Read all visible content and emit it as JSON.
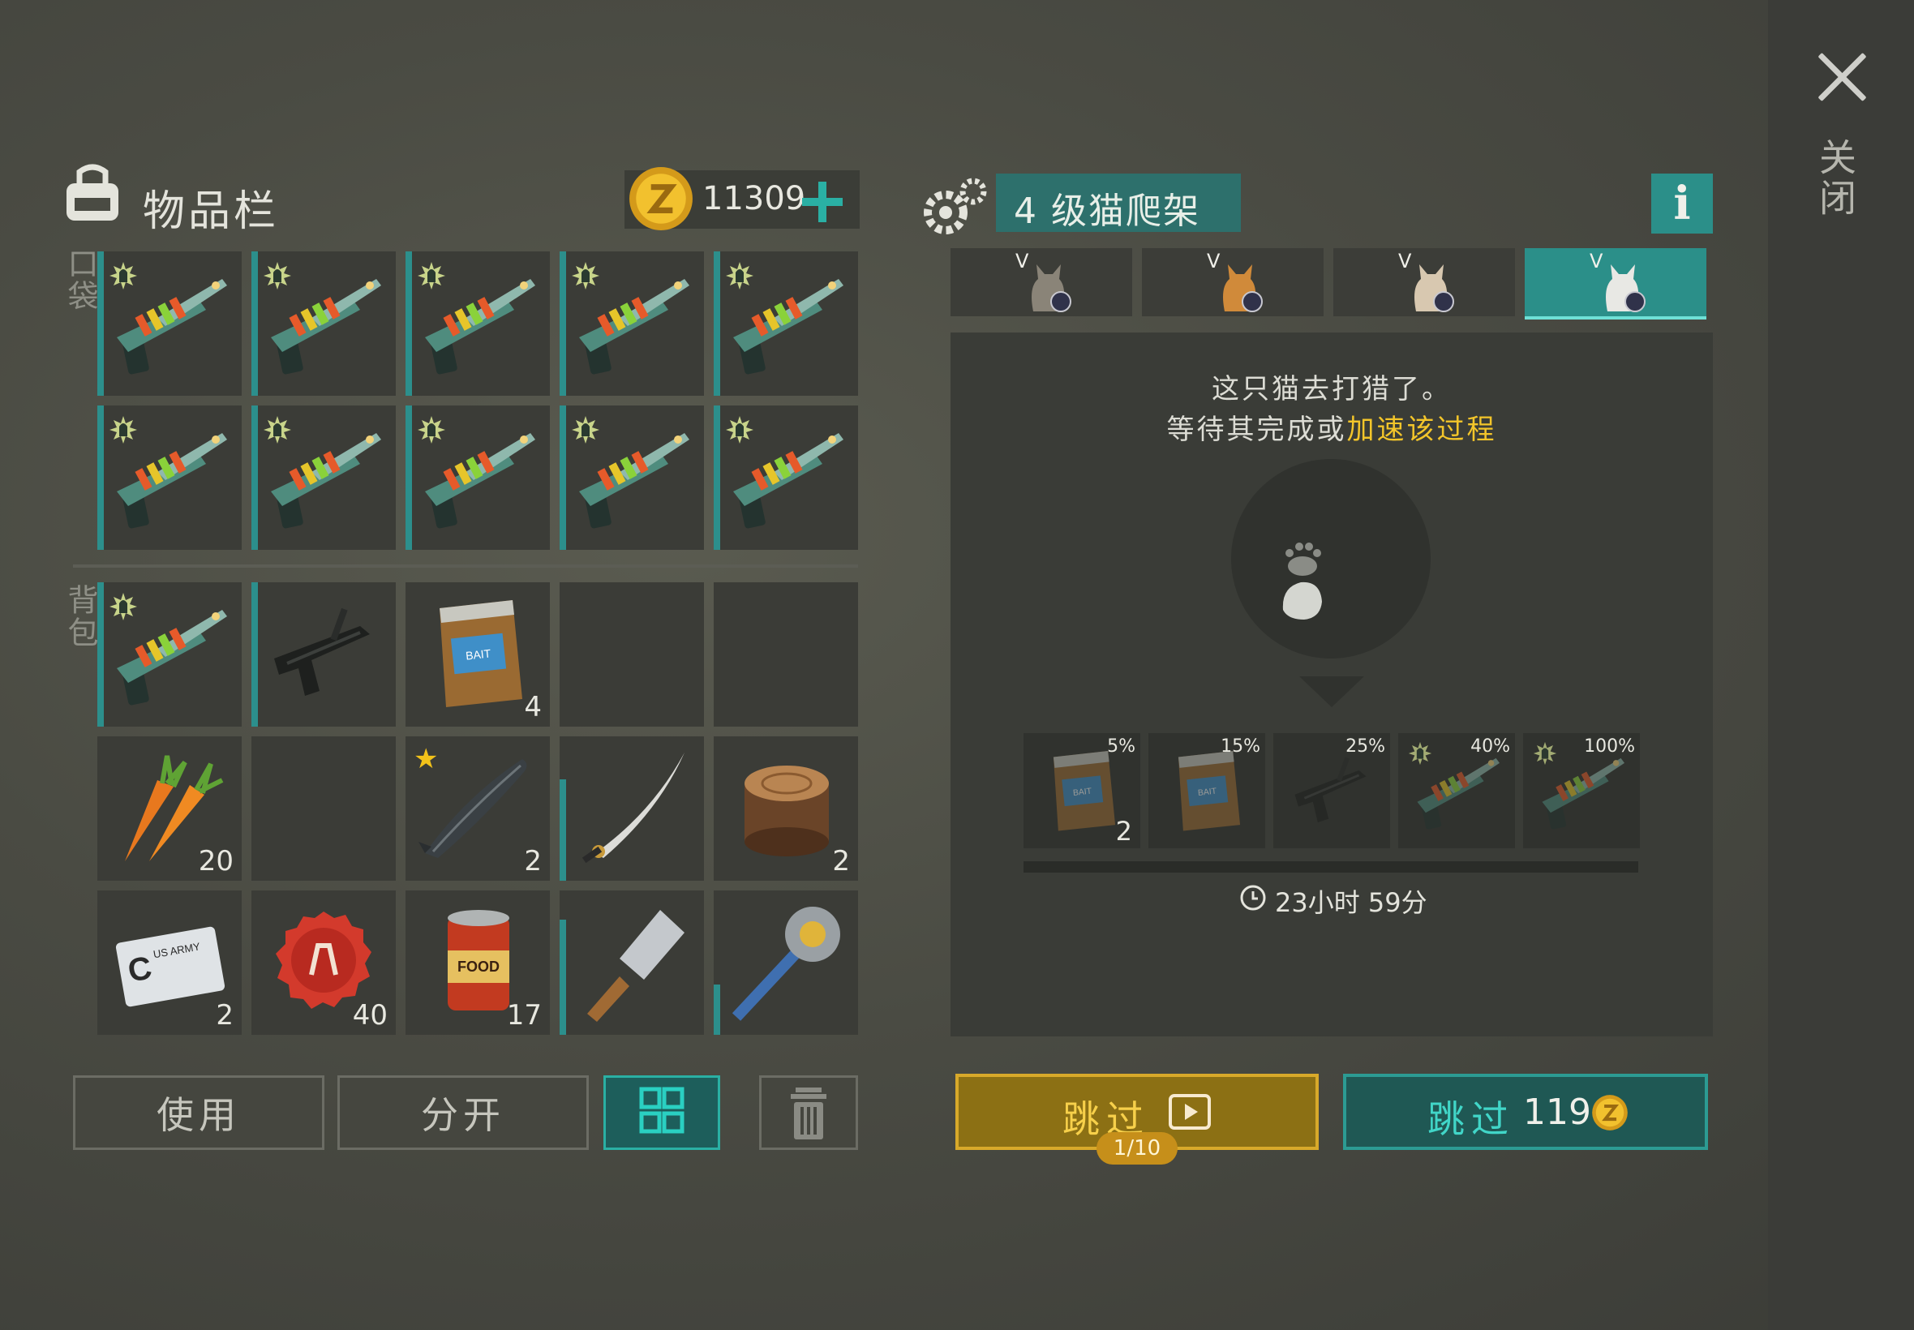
{
  "close": {
    "label": "关闭"
  },
  "inventory": {
    "title": "物品栏",
    "coins": "11309",
    "pocket_label": "口袋",
    "backpack_label": "背包",
    "pocket_slots": [
      {
        "item": "blaster-icon",
        "badge": true
      },
      {
        "item": "blaster-icon",
        "badge": true
      },
      {
        "item": "blaster-icon",
        "badge": true
      },
      {
        "item": "blaster-icon",
        "badge": true
      },
      {
        "item": "blaster-icon",
        "badge": true
      },
      {
        "item": "blaster-icon",
        "badge": true
      },
      {
        "item": "blaster-icon",
        "badge": true
      },
      {
        "item": "blaster-icon",
        "badge": true
      },
      {
        "item": "blaster-icon",
        "badge": true
      },
      {
        "item": "blaster-icon",
        "badge": true
      }
    ],
    "backpack_slots": [
      {
        "item": "blaster-icon",
        "badge": true,
        "count": ""
      },
      {
        "item": "uzi-icon",
        "count": ""
      },
      {
        "item": "bait-bag-icon",
        "count": "4"
      },
      {
        "item": "",
        "count": ""
      },
      {
        "item": "",
        "count": ""
      },
      {
        "item": "carrot-icon",
        "count": "20"
      },
      {
        "item": "",
        "count": ""
      },
      {
        "item": "sturgeon-icon",
        "count": "2",
        "star": true
      },
      {
        "item": "katana-icon",
        "count": ""
      },
      {
        "item": "wood-stump-icon",
        "count": "2"
      },
      {
        "item": "army-card-icon",
        "count": "2"
      },
      {
        "item": "bottle-cap-icon",
        "count": "40"
      },
      {
        "item": "food-can-icon",
        "count": "17"
      },
      {
        "item": "cleaver-icon",
        "count": ""
      },
      {
        "item": "saw-mace-icon",
        "count": ""
      }
    ],
    "buttons": {
      "use": "使用",
      "split": "分开"
    }
  },
  "cat_tree": {
    "title": "4 级猫爬架",
    "tabs": [
      {
        "tier": "V",
        "cat": "gray-tabby"
      },
      {
        "tier": "V",
        "cat": "orange-tabby"
      },
      {
        "tier": "V",
        "cat": "siamese"
      },
      {
        "tier": "V",
        "cat": "white",
        "active": true
      }
    ],
    "message_line1": "这只猫去打猎了。",
    "message_line2_prefix": "等待其完成或",
    "message_line2_link": "加速该过程",
    "rewards": [
      {
        "item": "bait-bag-icon",
        "pct": "5%",
        "count": "2"
      },
      {
        "item": "bait-bag-icon",
        "pct": "15%",
        "count": ""
      },
      {
        "item": "uzi-icon",
        "pct": "25%",
        "count": ""
      },
      {
        "item": "blaster-icon",
        "pct": "40%",
        "count": "",
        "badge": true
      },
      {
        "item": "blaster-icon",
        "pct": "100%",
        "count": "",
        "badge": true
      }
    ],
    "timer": "23小时 59分",
    "skip_ad": {
      "label": "跳过",
      "counter": "1/10"
    },
    "skip_coin": {
      "label": "跳过",
      "cost": "119"
    }
  },
  "colors": {
    "accent": "#2b8f89",
    "gold": "#f3c52a",
    "bg": "#4a4b43"
  }
}
